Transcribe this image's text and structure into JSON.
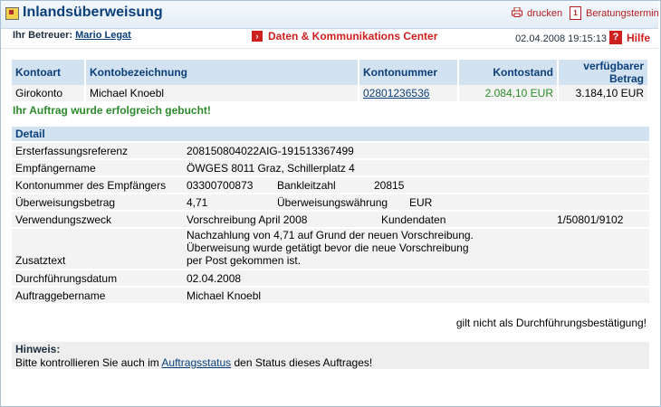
{
  "header": {
    "title": "Inlandsüberweisung",
    "print_label": "drucken",
    "appointment_label": "Beratungstermin"
  },
  "subheader": {
    "advisor_label": "Ihr Betreuer:",
    "advisor_name": "Mario Legat",
    "center_label": "Daten & Kommunikations Center",
    "datetime": "02.04.2008 19:15:13",
    "help_label": "Hilfe"
  },
  "account_table": {
    "headers": [
      "Kontoart",
      "Kontobezeichnung",
      "Kontonummer",
      "Kontostand",
      "verfügbarer Betrag"
    ],
    "row": {
      "type": "Girokonto",
      "name": "Michael Knoebl",
      "number": "02801236536",
      "balance": "2.084,10 EUR",
      "available": "3.184,10 EUR"
    }
  },
  "status_message": "Ihr Auftrag wurde erfolgreich gebucht!",
  "detail": {
    "heading": "Detail",
    "reference_label": "Ersterfassungsreferenz",
    "reference_value": "208150804022AIG-191513367499",
    "recipient_label": "Empfängername",
    "recipient_value": "ÖWGES 8011 Graz, Schillerplatz 4",
    "recipient_account_label": "Kontonummer des Empfängers",
    "recipient_account_value": "03300700873",
    "bank_code_label": "Bankleitzahl",
    "bank_code_value": "20815",
    "amount_label": "Überweisungsbetrag",
    "amount_value": "4,71",
    "currency_label": "Überweisungswährung",
    "currency_value": "EUR",
    "purpose_label": "Verwendungszweck",
    "purpose_value": "Vorschreibung April 2008",
    "customer_data_label": "Kundendaten",
    "customer_data_value": "1/50801/9102",
    "extra_label": "Zusatztext",
    "extra_line1": "Nachzahlung von 4,71 auf Grund der neuen Vorschreibung.",
    "extra_line2": "Überweisung wurde getätigt bevor die neue Vorschreibung",
    "extra_line3": "per Post gekommen ist.",
    "execution_date_label": "Durchführungsdatum",
    "execution_date_value": "02.04.2008",
    "orderer_label": "Auftraggebername",
    "orderer_value": "Michael Knoebl"
  },
  "confirmation_note": "gilt nicht als Durchführungsbestätigung!",
  "hint": {
    "heading": "Hinweis:",
    "text_before": "Bitte kontrollieren Sie auch im ",
    "link": "Auftragsstatus",
    "text_after": " den Status dieses Auftrages!"
  },
  "colors": {
    "title_blue": "#0b3f7a",
    "accent_red": "#cf2020",
    "success_green": "#2b8a2b",
    "header_bg": "#d3e2f0"
  }
}
